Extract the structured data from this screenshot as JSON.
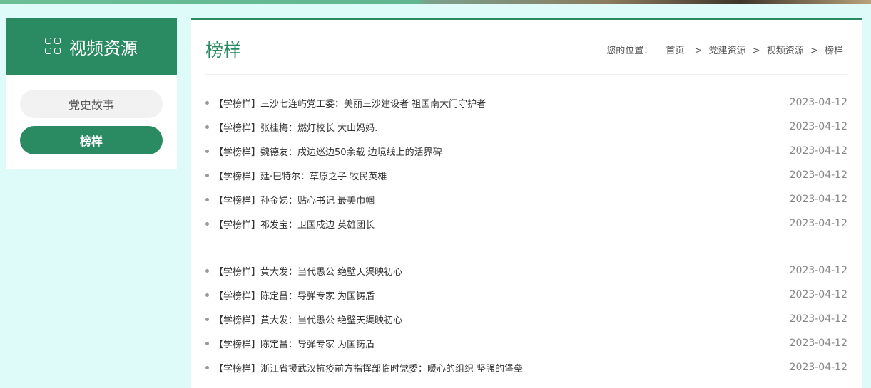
{
  "sidebar": {
    "title": "视频资源",
    "menu": [
      {
        "label": "党史故事",
        "active": false
      },
      {
        "label": "榜样",
        "active": true
      }
    ]
  },
  "main": {
    "title": "榜样",
    "breadcrumb": {
      "prefix": "您的位置：",
      "items": [
        "首页",
        "党建资源",
        "视频资源",
        "榜样"
      ],
      "separator": ">"
    },
    "group1": [
      {
        "title": "【学榜样】三沙七连屿党工委：美丽三沙建设者 祖国南大门守护者",
        "date": "2023-04-12"
      },
      {
        "title": "【学榜样】张桂梅：燃灯校长 大山妈妈.",
        "date": "2023-04-12"
      },
      {
        "title": "【学榜样】魏德友：戍边巡边50余载 边境线上的活界碑",
        "date": "2023-04-12"
      },
      {
        "title": "【学榜样】廷·巴特尔：草原之子 牧民英雄",
        "date": "2023-04-12"
      },
      {
        "title": "【学榜样】孙金娣：贴心书记 最美巾帼",
        "date": "2023-04-12"
      },
      {
        "title": "【学榜样】祁发宝：卫国戍边 英雄团长",
        "date": "2023-04-12"
      }
    ],
    "group2": [
      {
        "title": "【学榜样】黄大发：当代愚公 绝壁天渠映初心",
        "date": "2023-04-12"
      },
      {
        "title": "【学榜样】陈定昌：导弹专家 为国铸盾",
        "date": "2023-04-12"
      },
      {
        "title": "【学榜样】黄大发：当代愚公 绝壁天渠映初心",
        "date": "2023-04-12"
      },
      {
        "title": "【学榜样】陈定昌：导弹专家 为国铸盾",
        "date": "2023-04-12"
      },
      {
        "title": "【学榜样】浙江省援武汉抗疫前方指挥部临时党委：暖心的组织 坚强的堡垒",
        "date": "2023-04-12"
      }
    ]
  },
  "colors": {
    "accent": "#2a8a62",
    "background": "#dffbf9"
  }
}
